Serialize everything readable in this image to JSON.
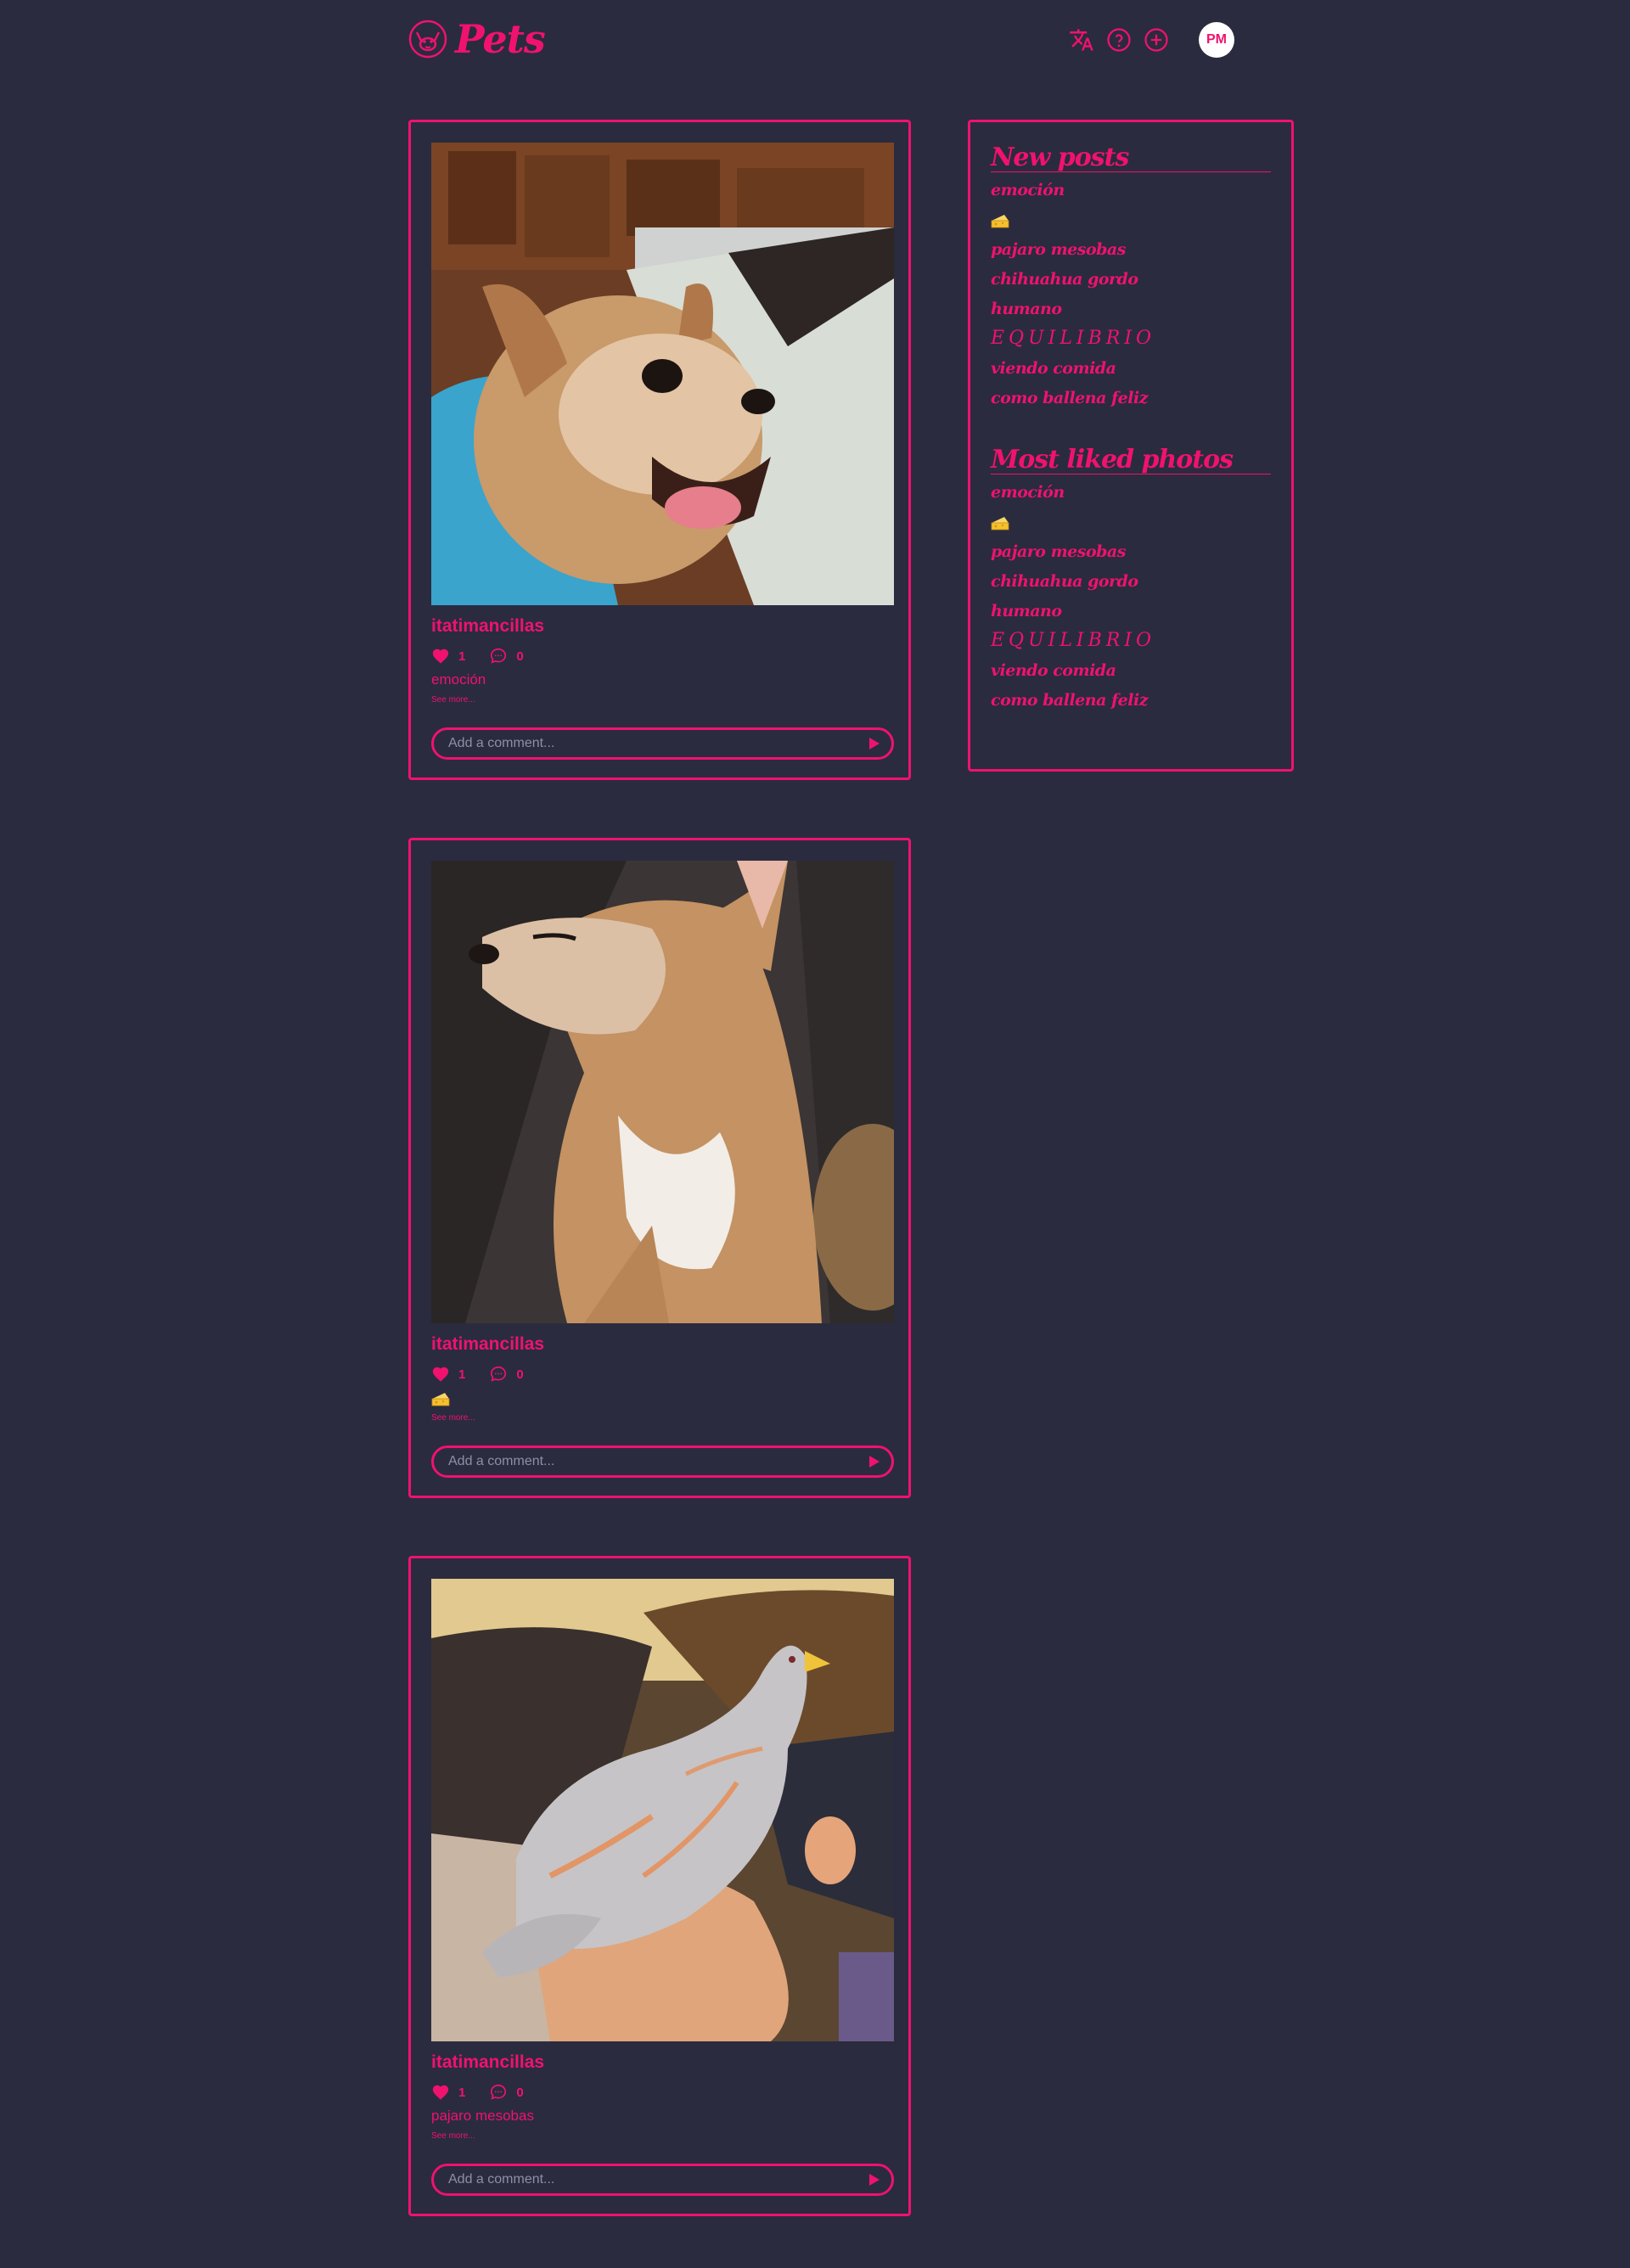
{
  "header": {
    "logo_text": "Pets",
    "avatar_initials": "PM",
    "icons": [
      "translate-icon",
      "help-icon",
      "add-post-icon"
    ]
  },
  "colors": {
    "accent": "#f0126e",
    "background": "#2a2b3f",
    "cheese": "#f5c12e"
  },
  "posts": [
    {
      "username": "itatimancillas",
      "likes": "1",
      "comments": "0",
      "caption": "emoción",
      "caption_is_emoji": false,
      "see_more": "See more...",
      "comment_placeholder": "Add a comment..."
    },
    {
      "username": "itatimancillas",
      "likes": "1",
      "comments": "0",
      "caption": "🧀",
      "caption_is_emoji": true,
      "see_more": "See more...",
      "comment_placeholder": "Add a comment..."
    },
    {
      "username": "itatimancillas",
      "likes": "1",
      "comments": "0",
      "caption": "pajaro mesobas",
      "caption_is_emoji": false,
      "see_more": "See more...",
      "comment_placeholder": "Add a comment..."
    }
  ],
  "sidebar": {
    "new_posts": {
      "title": "New posts",
      "items": [
        "emoción",
        "🧀",
        "pajaro mesobas",
        "chihuahua gordo",
        "humano",
        "EQUILIBRIO",
        "viendo comida",
        "como ballena feliz"
      ]
    },
    "most_liked": {
      "title": "Most liked photos",
      "items": [
        "emoción",
        "🧀",
        "pajaro mesobas",
        "chihuahua gordo",
        "humano",
        "EQUILIBRIO",
        "viendo comida",
        "como ballena feliz"
      ]
    }
  }
}
